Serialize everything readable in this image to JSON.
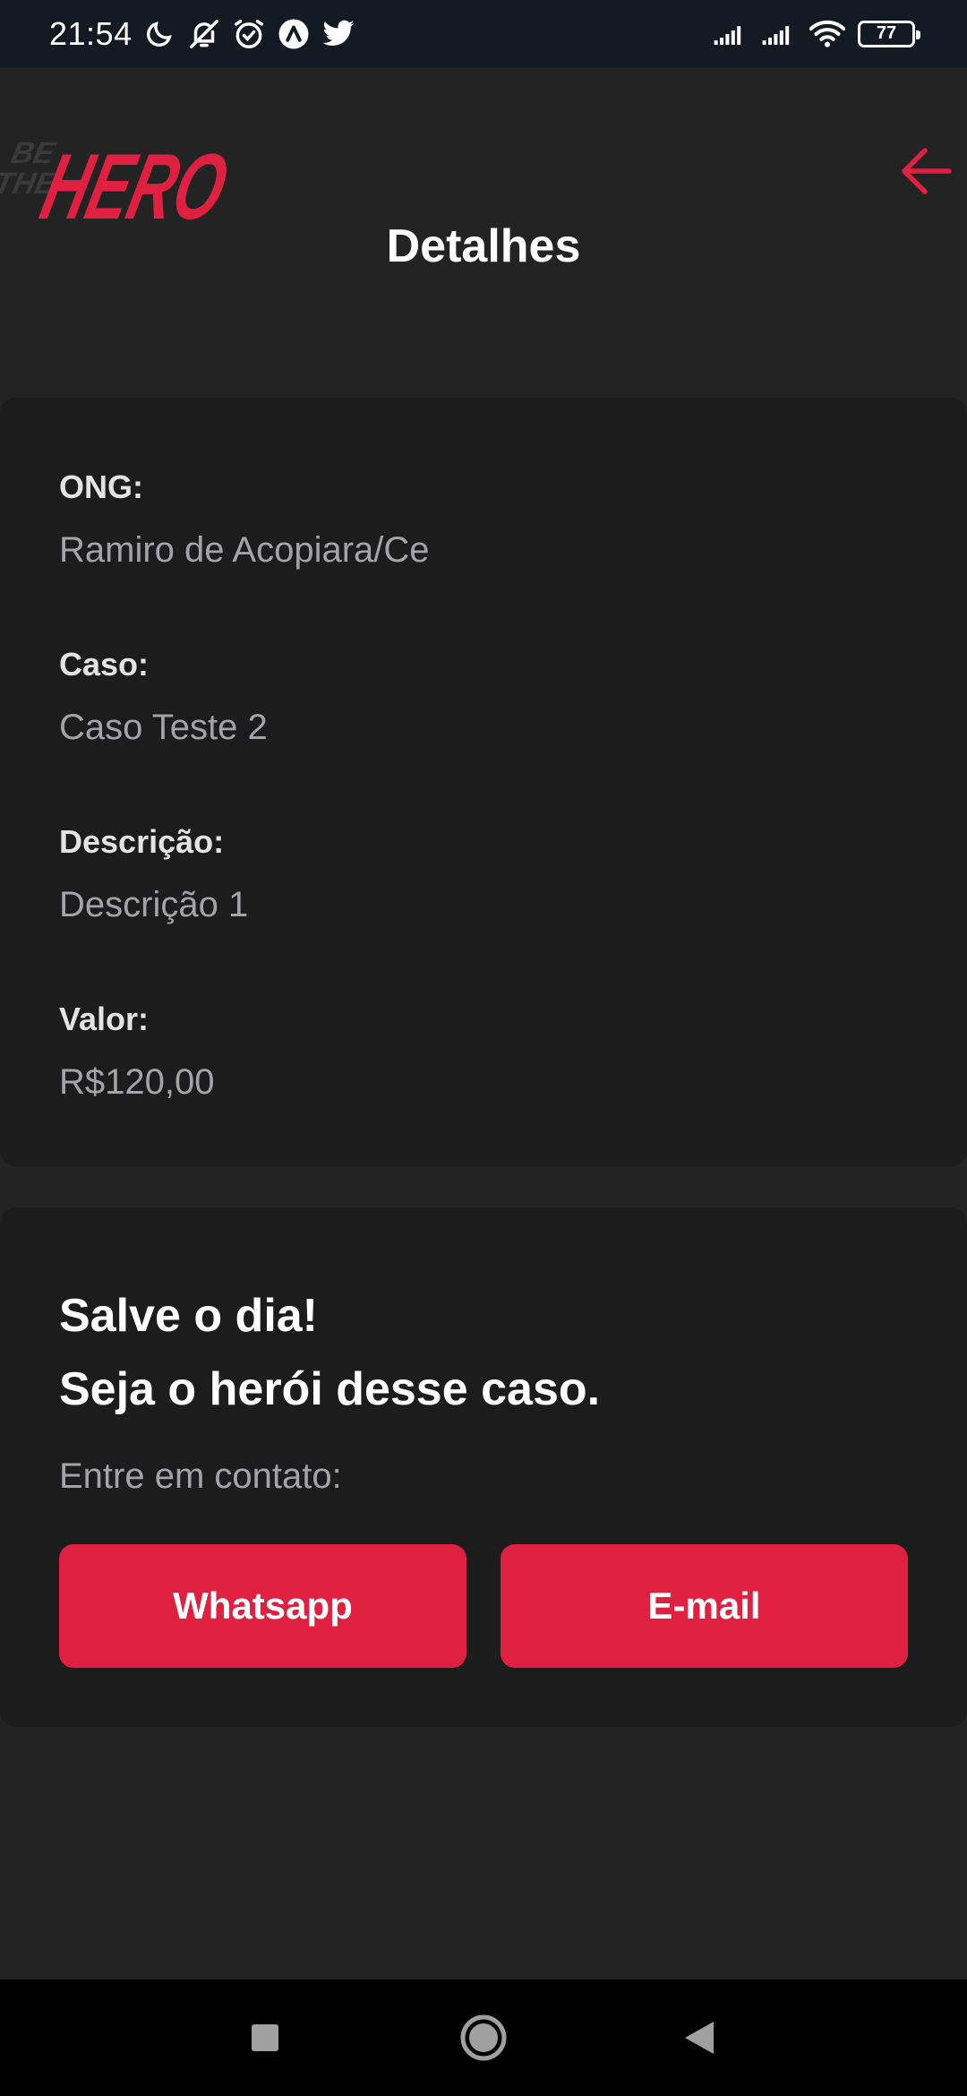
{
  "status_bar": {
    "time": "21:54",
    "battery": "77",
    "icons": [
      "moon-icon",
      "bell-off-icon",
      "alarm-icon",
      "app-a-icon",
      "twitter-icon",
      "signal-icon",
      "signal-icon",
      "wifi-icon",
      "battery-icon"
    ]
  },
  "header": {
    "logo_text_small": "BE THE",
    "logo_text_big": "HERO",
    "title": "Detalhes",
    "back_icon": "arrow-left-icon"
  },
  "details": {
    "ong_label": "ONG:",
    "ong_value": "Ramiro de Acopiara/Ce",
    "caso_label": "Caso:",
    "caso_value": "Caso Teste 2",
    "descricao_label": "Descrição:",
    "descricao_value": "Descrição 1",
    "valor_label": "Valor:",
    "valor_value": "R$120,00"
  },
  "contact": {
    "heading_line1": "Salve o dia!",
    "heading_line2": "Seja o herói desse caso.",
    "subtitle": "Entre em contato:",
    "whatsapp_label": "Whatsapp",
    "email_label": "E-mail"
  },
  "colors": {
    "accent": "#e02041",
    "background": "#232323",
    "card": "#1c1c1c",
    "muted_text": "#a3a3a8"
  },
  "nav_bar": {
    "icons": [
      "recent-apps-icon",
      "home-icon",
      "back-icon"
    ]
  }
}
